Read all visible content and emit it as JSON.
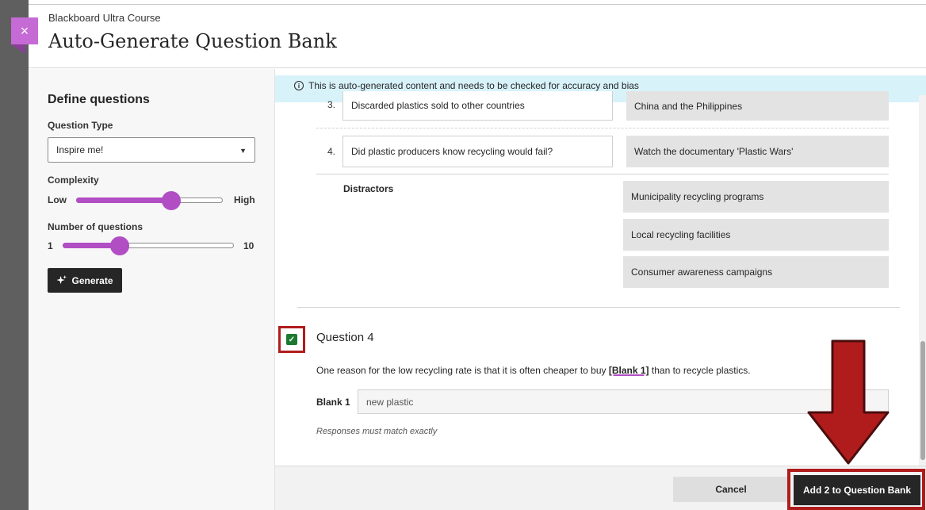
{
  "header": {
    "course_name": "Blackboard Ultra Course",
    "title": "Auto-Generate Question Bank",
    "close_glyph": "×"
  },
  "settings": {
    "title": "Define questions",
    "question_type_label": "Question Type",
    "question_type_value": "Inspire me!",
    "complexity_label": "Complexity",
    "complexity_low": "Low",
    "complexity_high": "High",
    "complexity_level": 0.65,
    "count_label": "Number of questions",
    "count_min": "1",
    "count_max": "10",
    "count_level": 0.33,
    "generate_label": "Generate"
  },
  "notice": {
    "text": "This is auto-generated content and needs to be checked for accuracy and bias"
  },
  "matching": {
    "pairs": [
      {
        "num": "3.",
        "prompt": "Discarded plastics sold to other countries",
        "answer": "China and the Philippines"
      },
      {
        "num": "4.",
        "prompt": "Did plastic producers know recycling would fail?",
        "answer": "Watch the documentary 'Plastic Wars'"
      }
    ],
    "distractors_label": "Distractors",
    "distractors": [
      "Municipality recycling programs",
      "Local recycling facilities",
      "Consumer awareness campaigns"
    ]
  },
  "question4": {
    "title": "Question 4",
    "text_before": "One reason for the low recycling rate is that it is often cheaper to buy ",
    "blank_ref": "[Blank 1]",
    "text_after": " than to recycle plastics.",
    "blank_label": "Blank 1",
    "blank_value": "new plastic",
    "note": "Responses must match exactly",
    "checked": true
  },
  "footer": {
    "cancel_label": "Cancel",
    "add_label": "Add 2 to Question Bank"
  },
  "colors": {
    "accent": "#b14ec4",
    "highlight": "#b01c1c",
    "checkbox": "#1b7a2f"
  },
  "icons": {
    "close": "close-icon",
    "info": "info-icon",
    "sparkle": "sparkle-icon",
    "caret": "chevron-down-icon",
    "check": "check-icon"
  }
}
